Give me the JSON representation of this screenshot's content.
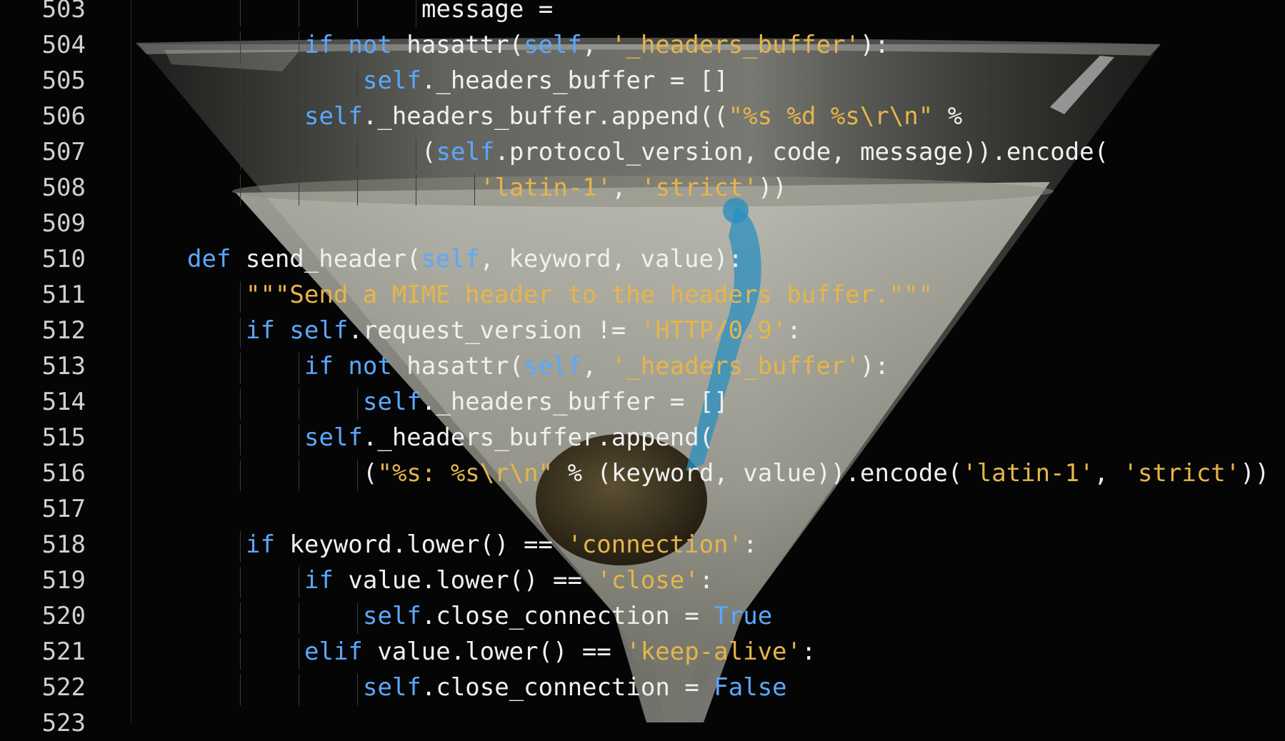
{
  "photo": {
    "subject": "martini-glass-with-olive",
    "overlay": "python-source-code",
    "colors": {
      "background": "#050505",
      "glass": "#9a9a90",
      "liquid": "#b8b8ac",
      "olive": "#3b3422",
      "pick": "#2a8fc0"
    }
  },
  "code": {
    "lines": [
      {
        "no": "503",
        "indent": 4,
        "tokens": [
          [
            "txt",
            "message ="
          ]
        ]
      },
      {
        "no": "504",
        "indent": 2,
        "tokens": [
          [
            "kw",
            "if not "
          ],
          [
            "fn",
            "hasattr("
          ],
          [
            "self",
            "self"
          ],
          [
            "txt",
            ", "
          ],
          [
            "str",
            "'_headers_buffer'"
          ],
          [
            "txt",
            "):"
          ]
        ]
      },
      {
        "no": "505",
        "indent": 3,
        "tokens": [
          [
            "self",
            "self"
          ],
          [
            "txt",
            "._headers_buffer = []"
          ]
        ]
      },
      {
        "no": "506",
        "indent": 2,
        "tokens": [
          [
            "self",
            "self"
          ],
          [
            "txt",
            "._headers_buffer.append(("
          ],
          [
            "str",
            "\"%s %d %s\\r\\n\""
          ],
          [
            "txt",
            " %"
          ]
        ]
      },
      {
        "no": "507",
        "indent": 4,
        "tokens": [
          [
            "txt",
            "("
          ],
          [
            "self",
            "self"
          ],
          [
            "txt",
            ".protocol_version, code, message)).encode("
          ]
        ]
      },
      {
        "no": "508",
        "indent": 5,
        "tokens": [
          [
            "str",
            "'latin-1'"
          ],
          [
            "txt",
            ", "
          ],
          [
            "str",
            "'strict'"
          ],
          [
            "txt",
            "))"
          ]
        ]
      },
      {
        "no": "509",
        "indent": 0,
        "tokens": []
      },
      {
        "no": "510",
        "indent": 0,
        "tokens": [
          [
            "kw",
            "def "
          ],
          [
            "fn",
            "send_header("
          ],
          [
            "self",
            "self"
          ],
          [
            "txt",
            ", keyword, value):"
          ]
        ]
      },
      {
        "no": "511",
        "indent": 1,
        "tokens": [
          [
            "str",
            "\"\"\"Send a MIME header to the headers buffer.\"\"\""
          ]
        ]
      },
      {
        "no": "512",
        "indent": 1,
        "tokens": [
          [
            "kw",
            "if "
          ],
          [
            "self",
            "self"
          ],
          [
            "txt",
            ".request_version != "
          ],
          [
            "str",
            "'HTTP/0.9'"
          ],
          [
            "txt",
            ":"
          ]
        ]
      },
      {
        "no": "513",
        "indent": 2,
        "tokens": [
          [
            "kw",
            "if not "
          ],
          [
            "fn",
            "hasattr("
          ],
          [
            "self",
            "self"
          ],
          [
            "txt",
            ", "
          ],
          [
            "str",
            "'_headers_buffer'"
          ],
          [
            "txt",
            "):"
          ]
        ]
      },
      {
        "no": "514",
        "indent": 3,
        "tokens": [
          [
            "self",
            "self"
          ],
          [
            "txt",
            "._headers_buffer = []"
          ]
        ]
      },
      {
        "no": "515",
        "indent": 2,
        "tokens": [
          [
            "self",
            "self"
          ],
          [
            "txt",
            "._headers_buffer.append("
          ]
        ]
      },
      {
        "no": "516",
        "indent": 3,
        "tokens": [
          [
            "txt",
            "("
          ],
          [
            "str",
            "\"%s: %s\\r\\n\""
          ],
          [
            "txt",
            " % (keyword, value)).encode("
          ],
          [
            "str",
            "'latin-1'"
          ],
          [
            "txt",
            ", "
          ],
          [
            "str",
            "'strict'"
          ],
          [
            "txt",
            "))"
          ]
        ]
      },
      {
        "no": "517",
        "indent": 0,
        "tokens": []
      },
      {
        "no": "518",
        "indent": 1,
        "tokens": [
          [
            "kw",
            "if "
          ],
          [
            "txt",
            "keyword.lower() == "
          ],
          [
            "str",
            "'connection'"
          ],
          [
            "txt",
            ":"
          ]
        ]
      },
      {
        "no": "519",
        "indent": 2,
        "tokens": [
          [
            "kw",
            "if "
          ],
          [
            "txt",
            "value.lower() == "
          ],
          [
            "str",
            "'close'"
          ],
          [
            "txt",
            ":"
          ]
        ]
      },
      {
        "no": "520",
        "indent": 3,
        "tokens": [
          [
            "self",
            "self"
          ],
          [
            "txt",
            ".close_connection = "
          ],
          [
            "bool",
            "True"
          ]
        ]
      },
      {
        "no": "521",
        "indent": 2,
        "tokens": [
          [
            "kw",
            "elif "
          ],
          [
            "txt",
            "value.lower() == "
          ],
          [
            "str",
            "'keep-alive'"
          ],
          [
            "txt",
            ":"
          ]
        ]
      },
      {
        "no": "522",
        "indent": 3,
        "tokens": [
          [
            "self",
            "self"
          ],
          [
            "txt",
            ".close_connection = "
          ],
          [
            "bool",
            "False"
          ]
        ]
      },
      {
        "no": "523",
        "indent": 0,
        "tokens": []
      }
    ]
  }
}
